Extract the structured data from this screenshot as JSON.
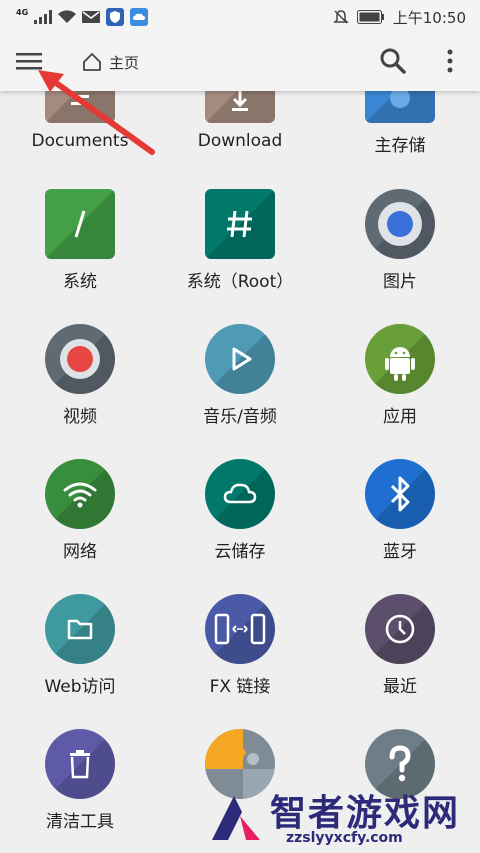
{
  "status_bar": {
    "network": "4G",
    "time": "上午10:50",
    "icons": [
      "signal-icon",
      "wifi-icon",
      "mail-icon",
      "shield-icon",
      "cloud-icon",
      "mute-icon",
      "battery-icon"
    ]
  },
  "toolbar": {
    "menu_icon": "hamburger-menu-icon",
    "home_label": "主页",
    "search_icon": "search-icon",
    "more_icon": "more-vert-icon"
  },
  "grid": {
    "items": [
      {
        "label": "Documents",
        "icon": "document-icon",
        "color": "#a58b7e"
      },
      {
        "label": "Download",
        "icon": "download-icon",
        "color": "#a58b7e"
      },
      {
        "label": "主存储",
        "icon": "storage-icon",
        "color": "#3b86d4"
      },
      {
        "label": "系统",
        "icon": "slash-icon",
        "color": "#43a047"
      },
      {
        "label": "系统（Root）",
        "icon": "hash-icon",
        "color": "#00796b"
      },
      {
        "label": "图片",
        "icon": "image-icon",
        "color": "#5f6a73"
      },
      {
        "label": "视频",
        "icon": "video-icon",
        "color": "#5f6a73"
      },
      {
        "label": "音乐/音频",
        "icon": "play-icon",
        "color": "#4f9bb5"
      },
      {
        "label": "应用",
        "icon": "android-icon",
        "color": "#689f38"
      },
      {
        "label": "网络",
        "icon": "wifi-icon",
        "color": "#388e3c"
      },
      {
        "label": "云储存",
        "icon": "cloud-icon",
        "color": "#00796b"
      },
      {
        "label": "蓝牙",
        "icon": "bluetooth-icon",
        "color": "#1e6fd0"
      },
      {
        "label": "Web访问",
        "icon": "folder-icon",
        "color": "#3f9aa0"
      },
      {
        "label": "FX 链接",
        "icon": "link-icon",
        "color": "#4a5aa6"
      },
      {
        "label": "最近",
        "icon": "clock-icon",
        "color": "#5b4f6b"
      },
      {
        "label": "清洁工具",
        "icon": "trash-icon",
        "color": "#5e5aa8"
      },
      {
        "label": "",
        "icon": "puzzle-icon",
        "color": "#e68a18"
      },
      {
        "label": "",
        "icon": "help-icon",
        "color": "#6e7e88"
      }
    ]
  },
  "watermark": {
    "title": "智者游戏网",
    "url": "zzslyyxcfy.com"
  },
  "colors": {
    "arrow": "#e53935",
    "watermark": "#2d2a7a"
  }
}
